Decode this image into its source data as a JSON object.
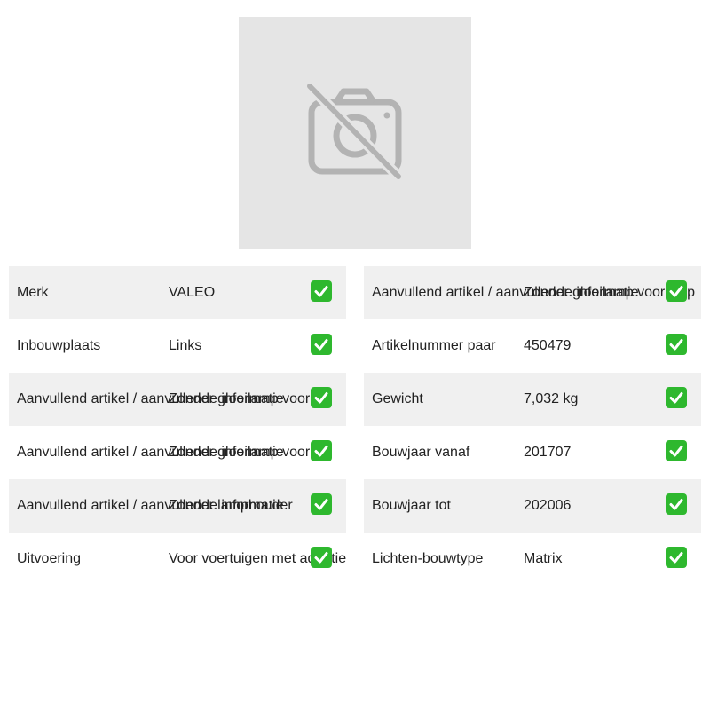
{
  "image": {
    "icon": "no-photo-camera-icon"
  },
  "left_specs": [
    {
      "label": "Merk",
      "value": "VALEO"
    },
    {
      "label": "Inbouwplaats",
      "value": "Links"
    },
    {
      "label": "Aanvullend artikel / aanvullende informatie",
      "value": "Zonder gloeilamp voor im"
    },
    {
      "label": "Aanvullend artikel / aanvullende informatie",
      "value": "Zonder gloeilamp voor ro"
    },
    {
      "label": "Aanvullend artikel / aanvullende informatie",
      "value": "Zonder lamphouder"
    },
    {
      "label": "Uitvoering",
      "value": "Voor voertuigen met adaptieve lichtfunctie (ooth"
    }
  ],
  "right_specs": [
    {
      "label": "Aanvullend artikel / aanvullende informatie",
      "value": "Zonder gloeilamp voor knip"
    },
    {
      "label": "Artikelnummer paar",
      "value": "450479"
    },
    {
      "label": "Gewicht",
      "value": "7,032 kg"
    },
    {
      "label": "Bouwjaar vanaf",
      "value": "201707"
    },
    {
      "label": "Bouwjaar tot",
      "value": "202006"
    },
    {
      "label": "Lichten-bouwtype",
      "value": "Matrix"
    }
  ],
  "check_icon": "check-mark-icon",
  "colors": {
    "check": "#2eb82e",
    "row_shade": "#f0f0f0",
    "image_bg": "#e5e5e5",
    "icon_gray": "#b3b3b3"
  }
}
